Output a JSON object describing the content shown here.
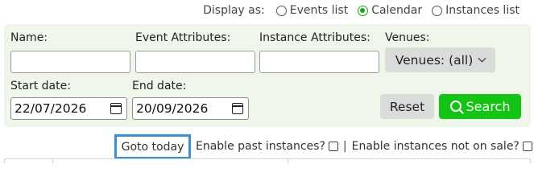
{
  "display_as": {
    "label": "Display as:",
    "options": [
      {
        "label": "Events list",
        "checked": false
      },
      {
        "label": "Calendar",
        "checked": true
      },
      {
        "label": "Instances list",
        "checked": false
      }
    ]
  },
  "filters": {
    "name_label": "Name:",
    "name_value": "",
    "event_attr_label": "Event Attributes:",
    "event_attr_value": "",
    "instance_attr_label": "Instance Attributes:",
    "instance_attr_value": "",
    "venues_label": "Venues:",
    "venues_button": "Venues: (all)",
    "start_date_label": "Start date:",
    "start_date_value": "22/07/2026",
    "end_date_label": "End date:",
    "end_date_value": "20/09/2026"
  },
  "actions": {
    "reset_label": "Reset",
    "search_label": "Search"
  },
  "options_row": {
    "goto_today_label": "Goto today",
    "past_instances_label": "Enable past instances?",
    "separator": "|",
    "not_on_sale_label": "Enable instances not on sale?"
  },
  "colors": {
    "panel_bg": "#eef7ea",
    "accent_green": "#14c414",
    "focus_blue": "#3d8fd0"
  }
}
